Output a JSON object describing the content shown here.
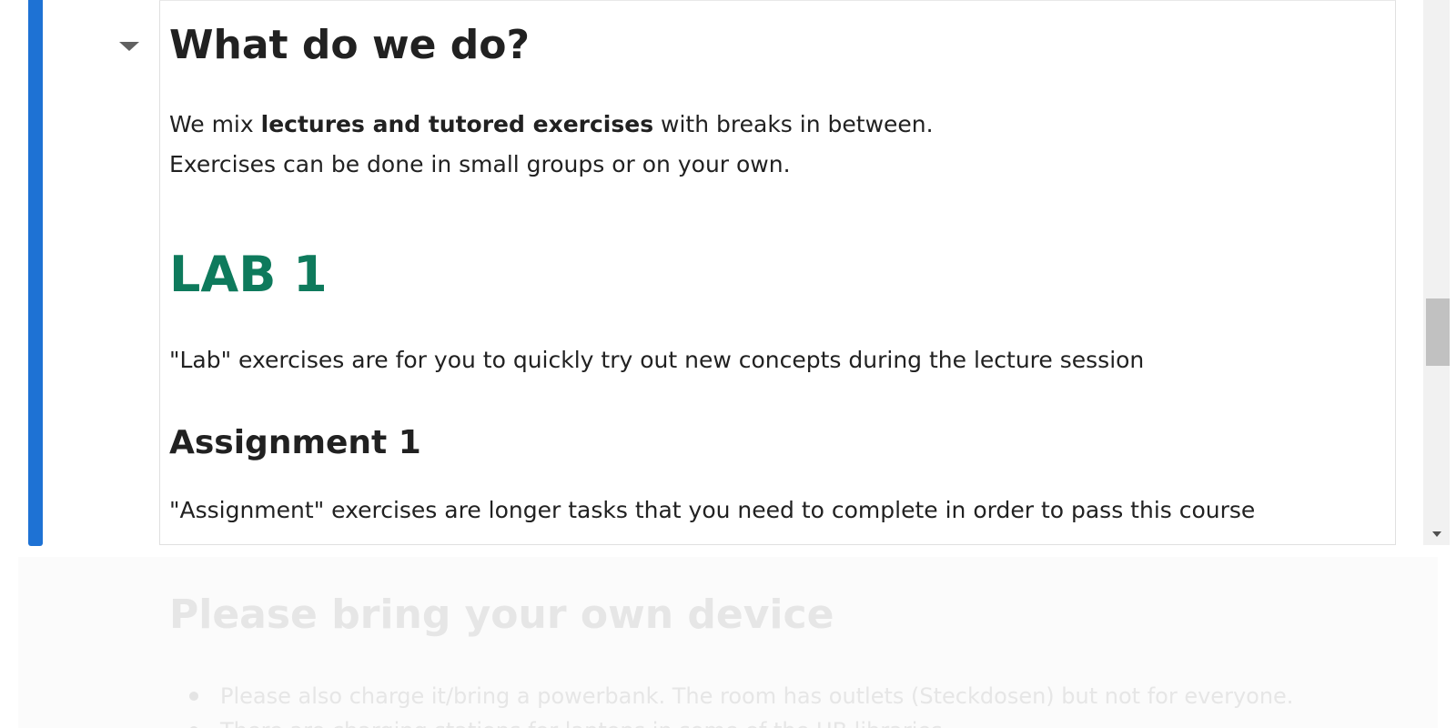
{
  "cell": {
    "heading": "What do we do?",
    "intro": {
      "line1_pre": "We mix ",
      "line1_bold": "lectures and tutored exercises",
      "line1_post": " with breaks in between.",
      "line2": "Exercises can be done in small groups or on your own."
    },
    "lab_heading": "LAB 1",
    "lab_text": "\"Lab\" exercises are for you to quickly try out new concepts during the lecture session",
    "assignment_heading": "Assignment 1",
    "assignment_text": "\"Assignment\" exercises are longer tasks that you need to complete in order to pass this course"
  },
  "next_cell": {
    "heading": "Please bring your own device",
    "items": [
      "Please also charge it/bring a powerbank. The room has outlets (Steckdosen) but not for everyone.",
      "There are charging stations for laptops in some of the UB libraries."
    ]
  },
  "colors": {
    "selection_bar": "#1e72d4",
    "lab_heading": "#0e7a5c"
  },
  "icons": {
    "collapse_toggle": "caret-down-icon",
    "scroll_down": "scroll-down-arrow-icon"
  }
}
